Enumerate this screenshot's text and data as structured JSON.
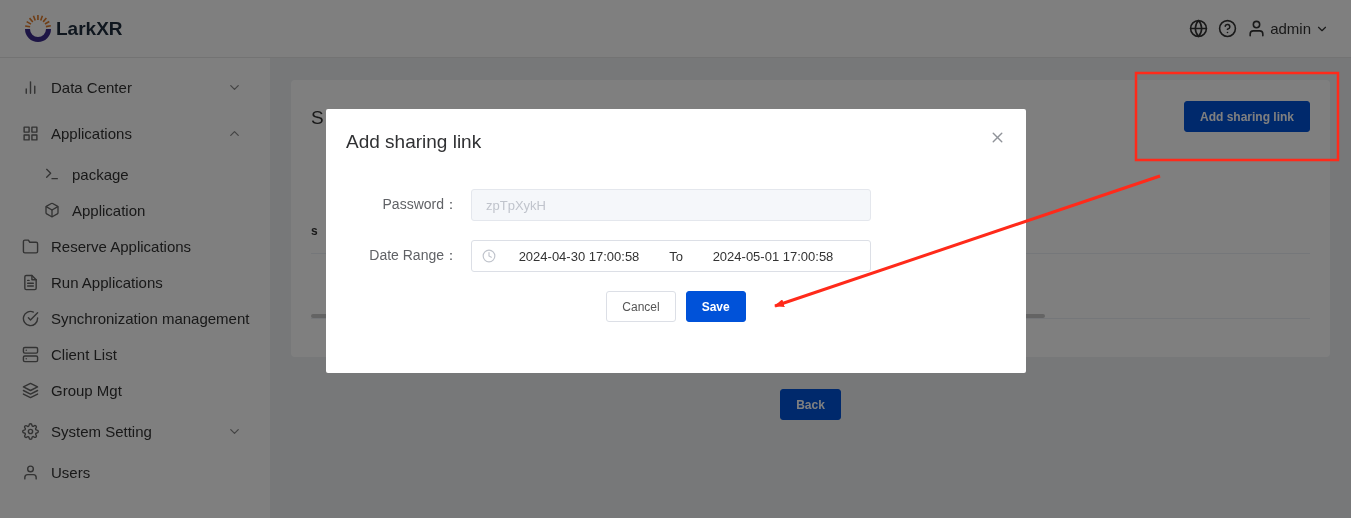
{
  "header": {
    "logo_text": "LarkXR",
    "user": "admin"
  },
  "sidebar": {
    "items": [
      {
        "label": "Data Center",
        "expanded": false
      },
      {
        "label": "Applications",
        "expanded": true,
        "children": [
          {
            "label": "package"
          },
          {
            "label": "Application"
          }
        ]
      },
      {
        "label": "Reserve Applications"
      },
      {
        "label": "Run Applications"
      },
      {
        "label": "Synchronization management"
      },
      {
        "label": "Client List"
      },
      {
        "label": "Group Mgt"
      },
      {
        "label": "System Setting",
        "expanded": false
      },
      {
        "label": "Users"
      }
    ]
  },
  "page": {
    "title": "S",
    "column_1": "s",
    "add_button": "Add sharing link",
    "back_button": "Back"
  },
  "dialog": {
    "title": "Add sharing link",
    "fields": [
      {
        "kind": "text",
        "label": "Password：",
        "value": "zpTpXykH",
        "disabled": true
      },
      {
        "kind": "range",
        "label": "Date Range：",
        "start": "2024-04-30 17:00:58",
        "separator": "To",
        "end": "2024-05-01 17:00:58"
      }
    ],
    "buttons": [
      {
        "label": "Cancel",
        "primary": false
      },
      {
        "label": "Save",
        "primary": true
      }
    ]
  }
}
